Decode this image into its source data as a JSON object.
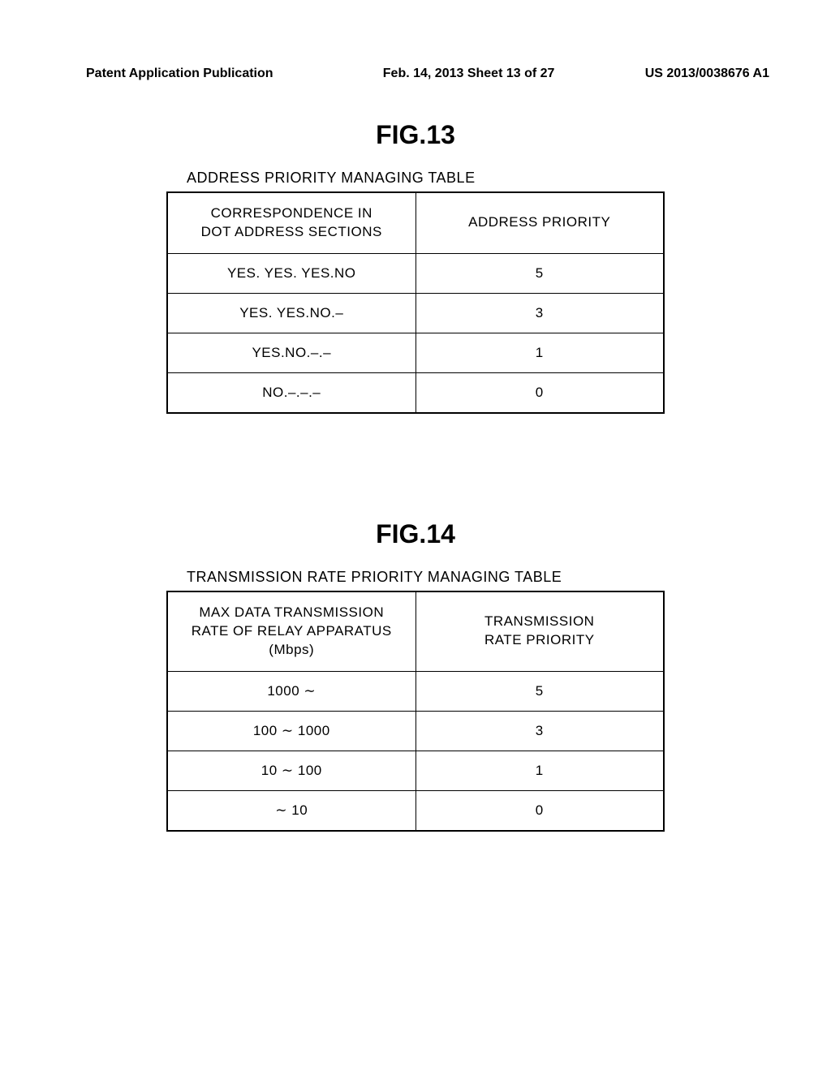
{
  "header": {
    "left": "Patent Application Publication",
    "center": "Feb. 14, 2013  Sheet 13 of 27",
    "right": "US 2013/0038676 A1"
  },
  "fig13": {
    "title": "FIG.13",
    "caption": "ADDRESS PRIORITY MANAGING TABLE",
    "headers": {
      "c1_line1": "CORRESPONDENCE IN",
      "c1_line2": "DOT ADDRESS SECTIONS",
      "c2": "ADDRESS PRIORITY"
    },
    "rows": [
      {
        "c1": "YES. YES. YES.NO",
        "c2": "5"
      },
      {
        "c1": "YES. YES.NO.–",
        "c2": "3"
      },
      {
        "c1": "YES.NO.–.–",
        "c2": "1"
      },
      {
        "c1": "NO.–.–.–",
        "c2": "0"
      }
    ]
  },
  "fig14": {
    "title": "FIG.14",
    "caption": "TRANSMISSION RATE PRIORITY MANAGING TABLE",
    "headers": {
      "c1_line1": "MAX DATA TRANSMISSION",
      "c1_line2": "RATE OF RELAY APPARATUS",
      "c1_line3": "(Mbps)",
      "c2_line1": "TRANSMISSION",
      "c2_line2": "RATE PRIORITY"
    },
    "rows": [
      {
        "c1": "1000 ∼",
        "c2": "5"
      },
      {
        "c1": "100 ∼ 1000",
        "c2": "3"
      },
      {
        "c1": "10 ∼ 100",
        "c2": "1"
      },
      {
        "c1": "∼ 10",
        "c2": "0"
      }
    ]
  },
  "chart_data": [
    {
      "type": "table",
      "title": "ADDRESS PRIORITY MANAGING TABLE",
      "columns": [
        "CORRESPONDENCE IN DOT ADDRESS SECTIONS",
        "ADDRESS PRIORITY"
      ],
      "rows": [
        [
          "YES. YES. YES.NO",
          5
        ],
        [
          "YES. YES.NO.–",
          3
        ],
        [
          "YES.NO.–.–",
          1
        ],
        [
          "NO.–.–.–",
          0
        ]
      ]
    },
    {
      "type": "table",
      "title": "TRANSMISSION RATE PRIORITY MANAGING TABLE",
      "columns": [
        "MAX DATA TRANSMISSION RATE OF RELAY APPARATUS (Mbps)",
        "TRANSMISSION RATE PRIORITY"
      ],
      "rows": [
        [
          "1000 ∼",
          5
        ],
        [
          "100 ∼ 1000",
          3
        ],
        [
          "10 ∼ 100",
          1
        ],
        [
          "∼ 10",
          0
        ]
      ]
    }
  ]
}
